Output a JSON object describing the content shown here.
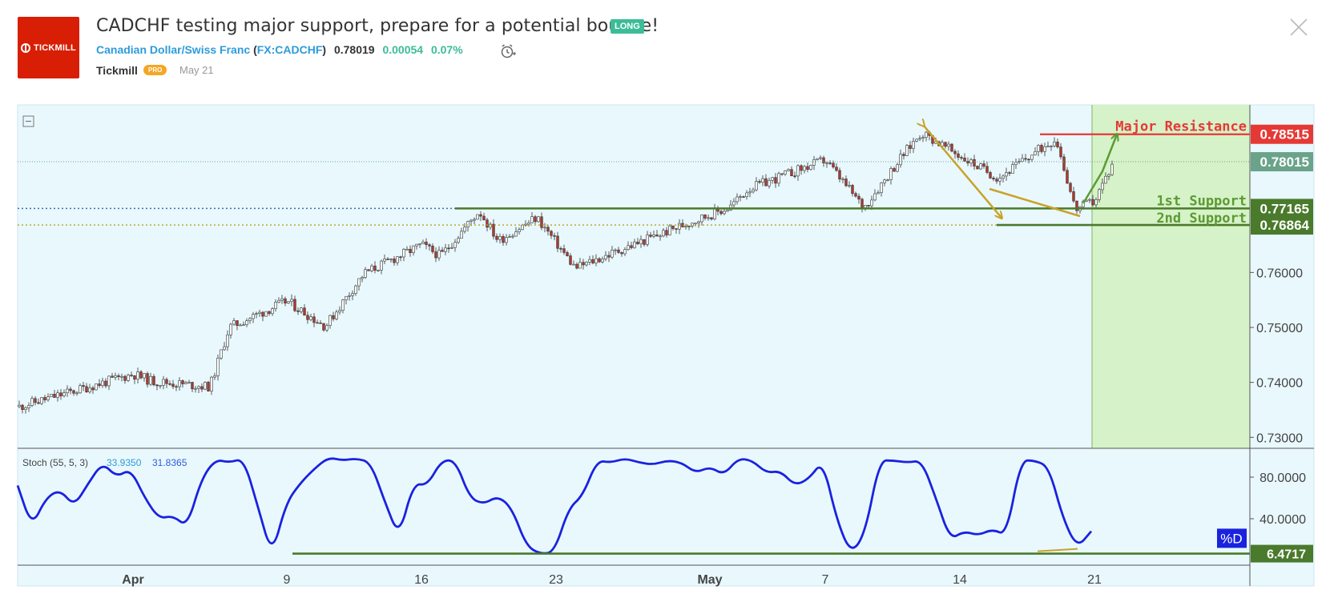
{
  "header": {
    "title": "CADCHF testing major support, prepare for a potential bounce!",
    "badge": "LONG",
    "instrument_name": "Canadian Dollar/Swiss Franc",
    "symbol": "FX:CADCHF",
    "price": "0.78019",
    "change": "0.00054",
    "change_pct": "0.07%",
    "author": "Tickmill",
    "author_badge": "PRO",
    "date": "May 21",
    "logo_text": "TICKMILL"
  },
  "colors": {
    "accent": "#2d9cdb",
    "positive": "#3cbc98",
    "brand": "#d81e05",
    "panel_bg": "#e9f8fd",
    "support": "#4a7a2b",
    "resistance": "#e53935",
    "arrow_orange": "#c9a227",
    "stoch_line": "#1a22e0"
  },
  "chart_data": [
    {
      "type": "candlestick",
      "x_ticks": [
        "Apr",
        "9",
        "16",
        "23",
        "May",
        "7",
        "14",
        "21"
      ],
      "y_ticks": [
        "0.73000",
        "0.74000",
        "0.75000",
        "0.76000"
      ],
      "ylim": [
        0.728,
        0.7905
      ],
      "approx_close_path": [
        [
          "Mar 26",
          0.7355
        ],
        [
          "Apr 1",
          0.7415
        ],
        [
          "Apr 2",
          0.7402
        ],
        [
          "Apr 5",
          0.7392
        ],
        [
          "Apr 6",
          0.75
        ],
        [
          "Apr 9",
          0.7548
        ],
        [
          "Apr 11",
          0.7502
        ],
        [
          "Apr 13",
          0.7598
        ],
        [
          "Apr 16",
          0.765
        ],
        [
          "Apr 17",
          0.763
        ],
        [
          "Apr 19",
          0.7712
        ],
        [
          "Apr 20",
          0.7658
        ],
        [
          "Apr 22",
          0.77
        ],
        [
          "Apr 24",
          0.7608
        ],
        [
          "Apr 30",
          0.7692
        ],
        [
          "May 2",
          0.7718
        ],
        [
          "May 3",
          0.7752
        ],
        [
          "May 7",
          0.7805
        ],
        [
          "May 9",
          0.7718
        ],
        [
          "May 11",
          0.7812
        ],
        [
          "May 12",
          0.7855
        ],
        [
          "May 14",
          0.7812
        ],
        [
          "May 16",
          0.7772
        ],
        [
          "May 19",
          0.7845
        ],
        [
          "May 20",
          0.7715
        ],
        [
          "May 21",
          0.773
        ],
        [
          "May 22",
          0.7802
        ]
      ],
      "levels": [
        {
          "label": "Major Resistance",
          "value": "0.78515"
        },
        {
          "label": "1st Support",
          "value": "0.77165"
        },
        {
          "label": "2nd Support",
          "value": "0.76864"
        }
      ],
      "current_price": "0.78015",
      "grid": false
    },
    {
      "type": "line",
      "indicator": "Stoch (55, 5, 3)",
      "values_shown": [
        "33.9350",
        "31.8365"
      ],
      "y_ticks": [
        "80.0000",
        "40.0000"
      ],
      "series_label": "%D",
      "support_value": "6.4717",
      "ylim": [
        0,
        100
      ],
      "approx_values": [
        72,
        32,
        60,
        68,
        52,
        74,
        94,
        80,
        88,
        60,
        40,
        43,
        32,
        78,
        97,
        94,
        98,
        52,
        4,
        55,
        74,
        88,
        99,
        96,
        98,
        94,
        56,
        22,
        74,
        72,
        96,
        96,
        60,
        54,
        62,
        50,
        14,
        6,
        8,
        50,
        62,
        96,
        94,
        98,
        94,
        92,
        96,
        94,
        84,
        90,
        82,
        98,
        96,
        84,
        86,
        72,
        78,
        96,
        38,
        6,
        26,
        96,
        96,
        94,
        96,
        60,
        20,
        28,
        24,
        30,
        24,
        96,
        96,
        90,
        40,
        12,
        28
      ]
    }
  ]
}
